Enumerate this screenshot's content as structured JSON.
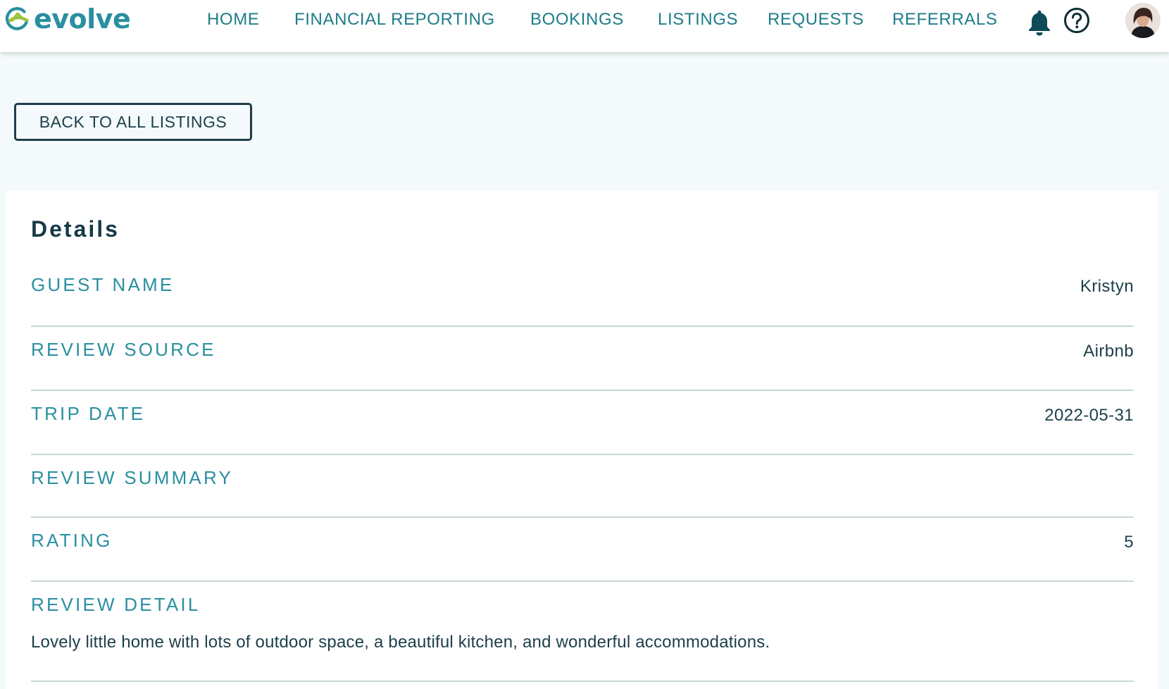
{
  "brand": {
    "name": "evolve",
    "color": "#2a8fa0",
    "accent": "#9cc53a"
  },
  "nav": {
    "items": [
      {
        "label": "HOME"
      },
      {
        "label": "FINANCIAL REPORTING"
      },
      {
        "label": "BOOKINGS"
      },
      {
        "label": "LISTINGS"
      },
      {
        "label": "REQUESTS"
      },
      {
        "label": "REFERRALS"
      }
    ],
    "icons": [
      "bell-icon",
      "help-circle-icon"
    ],
    "avatar": "user-avatar"
  },
  "back_button": {
    "label": "BACK TO ALL LISTINGS"
  },
  "details": {
    "title": "Details",
    "rows": [
      {
        "label": "GUEST NAME",
        "value": "Kristyn"
      },
      {
        "label": "REVIEW SOURCE",
        "value": "Airbnb"
      },
      {
        "label": "TRIP DATE",
        "value": "2022-05-31"
      },
      {
        "label": "REVIEW SUMMARY",
        "value": ""
      },
      {
        "label": "RATING",
        "value": "5"
      },
      {
        "label": "REVIEW DETAIL",
        "value": "Lovely little home with lots of outdoor space, a beautiful kitchen, and wonderful accommodations."
      }
    ]
  }
}
